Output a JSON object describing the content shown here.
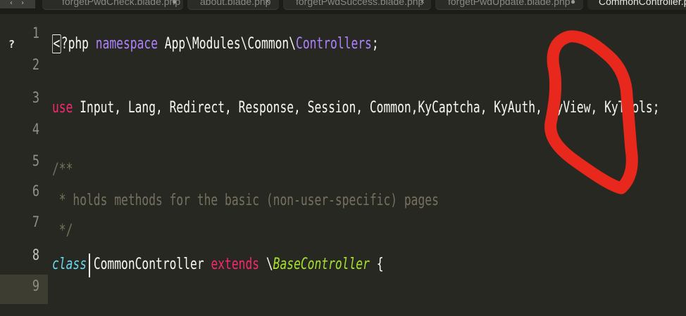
{
  "tabbar": {
    "nav_arrows": "‹ ›",
    "tabs": [
      {
        "label": "forgetPwdCheck.blade.php",
        "close": "●",
        "active": false
      },
      {
        "label": "about.blade.php",
        "close": "×",
        "active": false
      },
      {
        "label": "forgetPwdSuccess.blade.php",
        "close": "×",
        "active": false
      },
      {
        "label": "forgetPwdUpdate.blade.php",
        "close": "●",
        "active": false
      },
      {
        "label": "CommonController.php",
        "close": "",
        "active": true
      }
    ]
  },
  "editor": {
    "gutter_marker": "?",
    "current_line": 8,
    "line_numbers": [
      "1",
      "2",
      "3",
      "4",
      "5",
      "6",
      "7",
      "8",
      "9"
    ],
    "lines": [
      [
        {
          "t": "<",
          "c": "open"
        },
        {
          "t": "?php ",
          "c": "plain"
        },
        {
          "t": "namespace",
          "c": "ns"
        },
        {
          "t": " App\\Modules\\Common\\",
          "c": "plain"
        },
        {
          "t": "Controllers",
          "c": "ns"
        },
        {
          "t": ";",
          "c": "plain"
        }
      ],
      [],
      [
        {
          "t": "use",
          "c": "keyword"
        },
        {
          "t": " Input, Lang, Redirect, Response, Session, Common,KyCaptcha, KyAuth, KyView, KyTools;",
          "c": "plain"
        }
      ],
      [],
      [
        {
          "t": "/**",
          "c": "comment"
        }
      ],
      [
        {
          "t": " * holds methods for the basic (non-user-specific) pages",
          "c": "comment"
        }
      ],
      [
        {
          "t": " */",
          "c": "comment"
        }
      ],
      [
        {
          "t": "class",
          "c": "storage"
        },
        {
          "t": " CommonController ",
          "c": "plain"
        },
        {
          "t": "extends",
          "c": "keyword"
        },
        {
          "t": " \\",
          "c": "plain"
        },
        {
          "t": "BaseController",
          "c": "class"
        },
        {
          "t": " {",
          "c": "plain"
        }
      ],
      []
    ]
  },
  "colors": {
    "background": "#272822",
    "keyword": "#f92672",
    "storage": "#66d9ef",
    "namespace": "#ae81ff",
    "class": "#a6e22e",
    "comment": "#75715e",
    "annotation": "#e8281c"
  }
}
